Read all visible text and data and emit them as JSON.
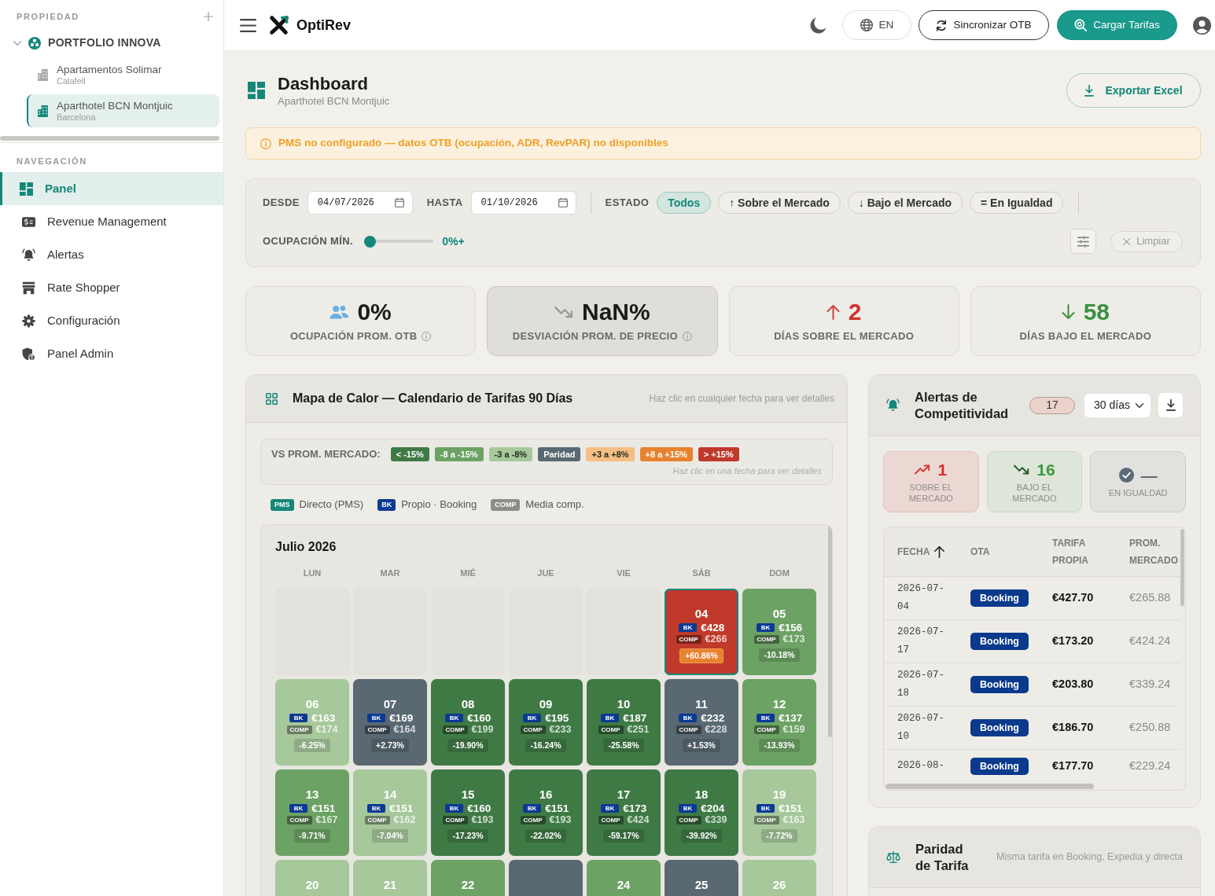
{
  "sidebar": {
    "property_heading": "PROPIEDAD",
    "portfolio": {
      "name": "PORTFOLIO INNOVA",
      "expanded": true,
      "children": [
        {
          "name": "Apartamentos Solimar",
          "city": "Calafell",
          "selected": false
        },
        {
          "name": "Aparthotel BCN Montjuic",
          "city": "Barcelona",
          "selected": true
        }
      ]
    },
    "nav_heading": "NAVEGACIÓN",
    "nav_items": [
      {
        "kind": "dashboard",
        "label": "Panel",
        "selected": true
      },
      {
        "kind": "revenue",
        "label": "Revenue Management",
        "selected": false
      },
      {
        "kind": "alerts",
        "label": "Alertas",
        "selected": false
      },
      {
        "kind": "shopper",
        "label": "Rate Shopper",
        "selected": false
      },
      {
        "kind": "settings",
        "label": "Configuración",
        "selected": false
      },
      {
        "kind": "admin",
        "label": "Panel Admin",
        "selected": false
      }
    ]
  },
  "topbar": {
    "brand": "OptiRev",
    "language": "EN",
    "sync_button": "Sincronizar OTB",
    "load_button": "Cargar Tarifas"
  },
  "page_header": {
    "title": "Dashboard",
    "subtitle": "Aparthotel BCN Montjuic",
    "export_button": "Exportar Excel"
  },
  "notice": {
    "text": "PMS no configurado — datos OTB (ocupación, ADR, RevPAR) no disponibles"
  },
  "filters": {
    "from_label": "DESDE",
    "from_value": "04/07/2026",
    "to_label": "HASTA",
    "to_value": "01/10/2026",
    "status_label": "ESTADO",
    "status_options": [
      {
        "label": "Todos",
        "selected": true
      },
      {
        "label": "↑ Sobre el Mercado",
        "selected": false
      },
      {
        "label": "↓ Bajo el Mercado",
        "selected": false
      },
      {
        "label": "= En Igualdad",
        "selected": false
      }
    ],
    "occupancy_label": "OCUPACIÓN MÍN.",
    "occupancy_slider": {
      "level": 0
    },
    "occupancy_reading": "0%+",
    "clear_button": {
      "label": "Limpiar",
      "disabled": true
    }
  },
  "kpis": [
    {
      "kind": "occupancy",
      "value": "0%",
      "label": "OCUPACIÓN PROM. OTB",
      "info": true,
      "selected": false
    },
    {
      "kind": "deviation",
      "value": "NaN%",
      "label": "DESVIACIÓN PROM. DE PRECIO",
      "info": true,
      "selected": true
    },
    {
      "kind": "above",
      "value": "2",
      "label": "DÍAS SOBRE EL MERCADO",
      "info": false,
      "selected": false
    },
    {
      "kind": "below",
      "value": "58",
      "label": "DÍAS BAJO EL MERCADO",
      "info": false,
      "selected": false
    }
  ],
  "heatmap": {
    "title": "Mapa de Calor — Calendario de Tarifas 90 Días",
    "hint": "Haz clic en cualquier fecha para ver detalles",
    "legend_label": "VS PROM. MERCADO:",
    "legend": [
      {
        "label": "< -15%",
        "color": "#3f7a45"
      },
      {
        "label": "-8 a -15%",
        "color": "#6ca264"
      },
      {
        "label": "-3 a -8%",
        "color": "#a6c89b"
      },
      {
        "label": "Paridad",
        "color": "#5a6872"
      },
      {
        "label": "+3 a +8%",
        "color": "#f5be84"
      },
      {
        "label": "+8 a +15%",
        "color": "#e8822f"
      },
      {
        "label": "> +15%",
        "color": "#c0392b"
      }
    ],
    "legend_hint": "Haz clic en una fecha para ver detalles",
    "sources": [
      {
        "badge": "PMS",
        "label": "Directo (PMS)",
        "color": "#15877a"
      },
      {
        "badge": "BK",
        "label": "Propio · Booking",
        "color": "#0b3a94"
      },
      {
        "badge": "COMP",
        "label": "Media comp.",
        "color": "#8e8d89"
      }
    ],
    "calendar": {
      "month": "Julio 2026",
      "weekdays": [
        "LUN",
        "MAR",
        "MIÉ",
        "JUE",
        "VIE",
        "SÁB",
        "DOM"
      ],
      "cells": [
        {
          "kind": "blank"
        },
        {
          "kind": "blank"
        },
        {
          "kind": "blank"
        },
        {
          "kind": "blank"
        },
        {
          "kind": "blank"
        },
        {
          "kind": "rate",
          "day": "04",
          "own_badge": "BK",
          "own": "€428",
          "comp_badge": "COMP",
          "comp": "€266",
          "diff": "+60.86%",
          "color": "#c0392b",
          "selected": true,
          "flagged": true
        },
        {
          "kind": "rate",
          "day": "05",
          "own_badge": "BK",
          "own": "€156",
          "comp_badge": "COMP",
          "comp": "€173",
          "diff": "-10.18%",
          "color": "#6ca264",
          "selected": false,
          "flagged": false
        },
        {
          "kind": "rate",
          "day": "06",
          "own_badge": "BK",
          "own": "€163",
          "comp_badge": "COMP",
          "comp": "€174",
          "diff": "-6.25%",
          "color": "#a6c89b",
          "selected": false,
          "flagged": false
        },
        {
          "kind": "rate",
          "day": "07",
          "own_badge": "BK",
          "own": "€169",
          "comp_badge": "COMP",
          "comp": "€164",
          "diff": "+2.73%",
          "color": "#5a6872",
          "selected": false,
          "flagged": false
        },
        {
          "kind": "rate",
          "day": "08",
          "own_badge": "BK",
          "own": "€160",
          "comp_badge": "COMP",
          "comp": "€199",
          "diff": "-19.90%",
          "color": "#3f7a45",
          "selected": false,
          "flagged": false
        },
        {
          "kind": "rate",
          "day": "09",
          "own_badge": "BK",
          "own": "€195",
          "comp_badge": "COMP",
          "comp": "€233",
          "diff": "-16.24%",
          "color": "#3f7a45",
          "selected": false,
          "flagged": false
        },
        {
          "kind": "rate",
          "day": "10",
          "own_badge": "BK",
          "own": "€187",
          "comp_badge": "COMP",
          "comp": "€251",
          "diff": "-25.58%",
          "color": "#3f7a45",
          "selected": false,
          "flagged": false
        },
        {
          "kind": "rate",
          "day": "11",
          "own_badge": "BK",
          "own": "€232",
          "comp_badge": "COMP",
          "comp": "€228",
          "diff": "+1.53%",
          "color": "#5a6872",
          "selected": false,
          "flagged": false
        },
        {
          "kind": "rate",
          "day": "12",
          "own_badge": "BK",
          "own": "€137",
          "comp_badge": "COMP",
          "comp": "€159",
          "diff": "-13.93%",
          "color": "#6ca264",
          "selected": false,
          "flagged": false
        },
        {
          "kind": "rate",
          "day": "13",
          "own_badge": "BK",
          "own": "€151",
          "comp_badge": "COMP",
          "comp": "€167",
          "diff": "-9.71%",
          "color": "#6ca264",
          "selected": false,
          "flagged": false
        },
        {
          "kind": "rate",
          "day": "14",
          "own_badge": "BK",
          "own": "€151",
          "comp_badge": "COMP",
          "comp": "€162",
          "diff": "-7.04%",
          "color": "#a6c89b",
          "selected": false,
          "flagged": false
        },
        {
          "kind": "rate",
          "day": "15",
          "own_badge": "BK",
          "own": "€160",
          "comp_badge": "COMP",
          "comp": "€193",
          "diff": "-17.23%",
          "color": "#3f7a45",
          "selected": false,
          "flagged": false
        },
        {
          "kind": "rate",
          "day": "16",
          "own_badge": "BK",
          "own": "€151",
          "comp_badge": "COMP",
          "comp": "€193",
          "diff": "-22.02%",
          "color": "#3f7a45",
          "selected": false,
          "flagged": false
        },
        {
          "kind": "rate",
          "day": "17",
          "own_badge": "BK",
          "own": "€173",
          "comp_badge": "COMP",
          "comp": "€424",
          "diff": "-59.17%",
          "color": "#3f7a45",
          "selected": false,
          "flagged": false
        },
        {
          "kind": "rate",
          "day": "18",
          "own_badge": "BK",
          "own": "€204",
          "comp_badge": "COMP",
          "comp": "€339",
          "diff": "-39.92%",
          "color": "#3f7a45",
          "selected": false,
          "flagged": false
        },
        {
          "kind": "rate",
          "day": "19",
          "own_badge": "BK",
          "own": "€151",
          "comp_badge": "COMP",
          "comp": "€163",
          "diff": "-7.72%",
          "color": "#a6c89b",
          "selected": false,
          "flagged": false
        },
        {
          "kind": "partial",
          "day": "20",
          "color": "#a6c89b",
          "selected": false
        },
        {
          "kind": "partial",
          "day": "21",
          "color": "#a6c89b",
          "selected": false
        },
        {
          "kind": "partial",
          "day": "22",
          "color": "#6ca264",
          "selected": false
        },
        {
          "kind": "partial",
          "color": "#5a6872",
          "selected": false
        },
        {
          "kind": "partial",
          "day": "24",
          "color": "#6ca264",
          "selected": false
        },
        {
          "kind": "partial",
          "day": "25",
          "color": "#5a6872",
          "selected": false
        },
        {
          "kind": "partial",
          "day": "26",
          "color": "#a6c89b",
          "selected": false
        }
      ]
    }
  },
  "alerts": {
    "title": "Alertas de Competitividad",
    "count": "17",
    "period": "30 días",
    "summary": [
      {
        "kind": "above",
        "value": "1",
        "label": "SOBRE EL MERCADO"
      },
      {
        "kind": "below",
        "value": "16",
        "label": "BAJO EL MERCADO"
      },
      {
        "kind": "parity",
        "value": "—",
        "label": "EN IGUALDAD"
      }
    ],
    "table": {
      "columns": [
        {
          "label": "FECHA",
          "sorted": true
        },
        {
          "label": "OTA",
          "sorted": false
        },
        {
          "label": "TARIFA PROPIA",
          "sorted": false
        },
        {
          "label": "PROM. MERCADO",
          "sorted": false
        }
      ],
      "rows": [
        {
          "date": "2026-07-04",
          "ota": "Booking",
          "own": "€427.70",
          "market": "€265.88"
        },
        {
          "date": "2026-07-17",
          "ota": "Booking",
          "own": "€173.20",
          "market": "€424.24"
        },
        {
          "date": "2026-07-18",
          "ota": "Booking",
          "own": "€203.80",
          "market": "€339.24"
        },
        {
          "date": "2026-07-10",
          "ota": "Booking",
          "own": "€186.70",
          "market": "€250.88"
        },
        {
          "date": "2026-08-",
          "ota": "Booking",
          "own": "€177.70",
          "market": "€229.24"
        }
      ]
    }
  },
  "parity": {
    "title": "Paridad de Tarifa",
    "hint": "Misma tarifa en Booking, Expedia y directa"
  }
}
